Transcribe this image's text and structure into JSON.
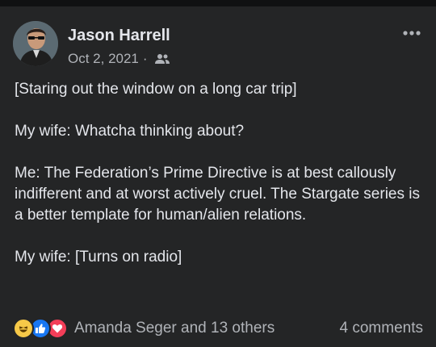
{
  "post": {
    "author": "Jason Harrell",
    "date": "Oct 2, 2021",
    "separator": "·",
    "audience_icon": "friends-icon",
    "more_icon": "more-options-icon",
    "paragraphs": [
      "[Staring out the window on a long car trip]",
      "My wife: Whatcha thinking about?",
      "Me: The Federation’s Prime Directive is at best callously indifferent and at worst actively cruel. The Stargate series is a better template for human/alien relations.",
      "My wife: [Turns on radio]"
    ]
  },
  "footer": {
    "reaction_icons": [
      "haha-reaction-icon",
      "like-reaction-icon",
      "love-reaction-icon"
    ],
    "reactors": "Amanda Seger and 13 others",
    "comments": "4 comments"
  },
  "colors": {
    "background": "#242526",
    "text": "#e4e6eb",
    "secondary_text": "#b0b3b8",
    "like": "#1877f2",
    "love": "#f33e58",
    "haha": "#f7c948"
  }
}
